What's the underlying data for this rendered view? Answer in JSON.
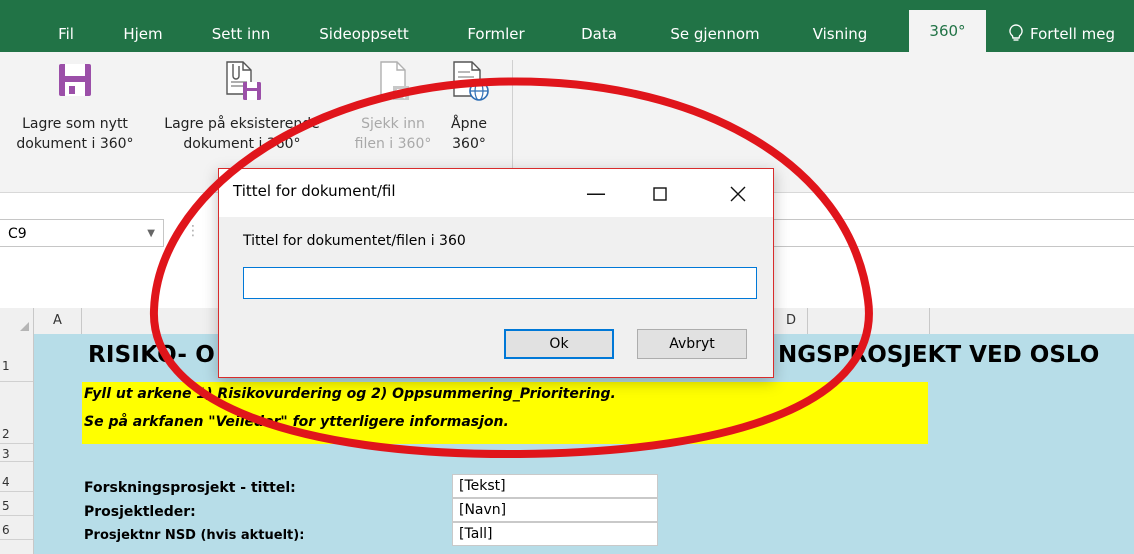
{
  "ribbon_tabs": [
    {
      "label": "Fil"
    },
    {
      "label": "Hjem"
    },
    {
      "label": "Sett inn"
    },
    {
      "label": "Sideoppsett"
    },
    {
      "label": "Formler"
    },
    {
      "label": "Data"
    },
    {
      "label": "Se gjennom"
    },
    {
      "label": "Visning"
    },
    {
      "label": "360°",
      "active": true
    },
    {
      "label": "Fortell meg"
    }
  ],
  "ribbon_buttons": [
    {
      "line1": "Lagre som nytt",
      "line2": "dokument i 360°",
      "icon": "save-icon",
      "enabled": true
    },
    {
      "line1": "Lagre på eksisterende",
      "line2": "dokument i 360°",
      "icon": "save-to-existing-icon",
      "enabled": true
    },
    {
      "line1": "Sjekk inn",
      "line2": "filen i 360°",
      "icon": "check-in-icon",
      "enabled": false
    },
    {
      "line1": "Åpne",
      "line2": "360°",
      "icon": "open-web-icon",
      "enabled": true
    }
  ],
  "name_box": {
    "value": "C9"
  },
  "columns": [
    "A",
    "D"
  ],
  "rows": [
    "1",
    "2",
    "3",
    "4",
    "5",
    "6"
  ],
  "sheet": {
    "title_left": "RISIKO- O",
    "title_right": "NGSPROSJEKT VED OSLO",
    "instructions": [
      "Fyll ut arkene 1) Risikovurdering og 2) Oppsummering_Prioritering.",
      "Se på arkfanen \"Veileder\" for ytterligere informasjon."
    ],
    "fields": [
      {
        "label": "Forskningsprosjekt - tittel:",
        "value": "[Tekst]"
      },
      {
        "label": "Prosjektleder:",
        "value": "[Navn]"
      },
      {
        "label": "Prosjektnr NSD (hvis aktuelt):",
        "value": "[Tall]"
      }
    ]
  },
  "dialog": {
    "title": "Tittel for dokument/fil",
    "prompt": "Tittel for dokumentet/filen i 360",
    "input_value": "",
    "ok_label": "Ok",
    "cancel_label": "Avbryt"
  },
  "colors": {
    "excel_green": "#217346",
    "sheet_fill": "#b7dde8",
    "highlight": "#ffff00",
    "annotation": "#e0151b"
  }
}
